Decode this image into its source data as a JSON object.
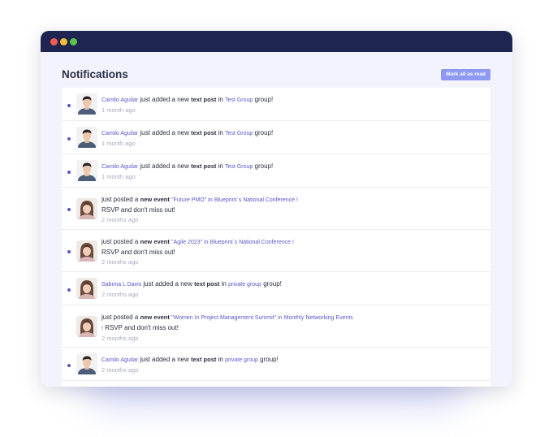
{
  "header": {
    "title": "Notifications",
    "mark_all_label": "Mark all as read"
  },
  "colors": {
    "titlebar": "#1e2550",
    "accent": "#5a57c9",
    "button": "#8d99f2",
    "window_bg": "#f2f3fd"
  },
  "notifications": [
    {
      "actor": "Camilo Aguilar",
      "p1": "just added a new",
      "bold": "text post",
      "p2": "in",
      "target": "Test Group",
      "p3": "group!",
      "time": "1 month ago"
    },
    {
      "actor": "Camilo Aguilar",
      "p1": "just added a new",
      "bold": "text post",
      "p2": "in",
      "target": "Test Group",
      "p3": "group!",
      "time": "1 month ago"
    },
    {
      "actor": "Camilo Aguilar",
      "p1": "just added a new",
      "bold": "text post",
      "p2": "in",
      "target": "Test Group",
      "p3": "group!",
      "time": "1 month ago"
    },
    {
      "p1": "just posted a",
      "bold": "new event",
      "event": "\"Future PMO\" in",
      "target": "Blueprint´s National Conference !",
      "rsvp": "RSVP and don't miss out!",
      "time": "2 months ago"
    },
    {
      "p1": "just posted a",
      "bold": "new event",
      "event": "\"Agile 2023\" in",
      "target": "Blueprint´s National Conference !",
      "rsvp": "RSVP and don't miss out!",
      "time": "2 months ago"
    },
    {
      "actor": "Sabrina L Davis",
      "p1": "just added a new",
      "bold": "text post",
      "p2": "in",
      "target": "private group",
      "p3": "group!",
      "time": "2 months ago"
    },
    {
      "p1": "just posted a",
      "bold": "new event",
      "event": "\"Women In Project Management Summit\" in",
      "target_a": "Monthly",
      "target_b": "Networking Events !",
      "rsvp": "RSVP and don't miss out!",
      "time": "2 months ago"
    },
    {
      "actor": "Camilo Aguilar",
      "p1": "just added a new",
      "bold": "text post",
      "p2": "in",
      "target": "private group",
      "p3": "group!",
      "time": "2 months ago"
    }
  ]
}
